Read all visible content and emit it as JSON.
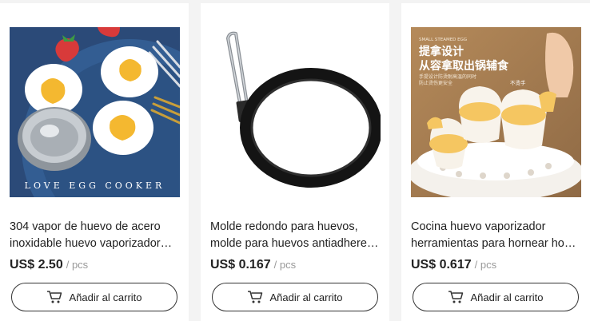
{
  "products": [
    {
      "title_line1": "304 vapor de huevo de acero",
      "title_line2": "inoxidable huevo vaporizador…",
      "price": "US$ 2.50",
      "unit": "/ pcs",
      "image_text": "LOVE EGG COOKER",
      "cart_label": "Añadir al carrito"
    },
    {
      "title_line1": "Molde redondo para huevos,",
      "title_line2": "molde para huevos antiadherent…",
      "price": "US$ 0.167",
      "unit": "/ pcs",
      "cart_label": "Añadir al carrito"
    },
    {
      "title_line1": "Cocina huevo vaporizador",
      "title_line2": "herramientas para hornear hoga…",
      "price": "US$ 0.617",
      "unit": "/ pcs",
      "image_text_top": "SMALL STEAMED EGG",
      "image_text_main1": "提拿设计",
      "image_text_main2": "从容拿取出锅辅食",
      "image_text_sub1": "手提设计防烫耐高温的同时",
      "image_text_sub2": "防止烫伤更安全",
      "image_text_tag": "不烫手",
      "cart_label": "Añadir al carrito"
    }
  ],
  "colors": {
    "page_bg": "#f3f3f3",
    "card_bg": "#ffffff",
    "text": "#222222",
    "muted": "#999999"
  },
  "icons": {
    "cart": "cart-icon"
  }
}
